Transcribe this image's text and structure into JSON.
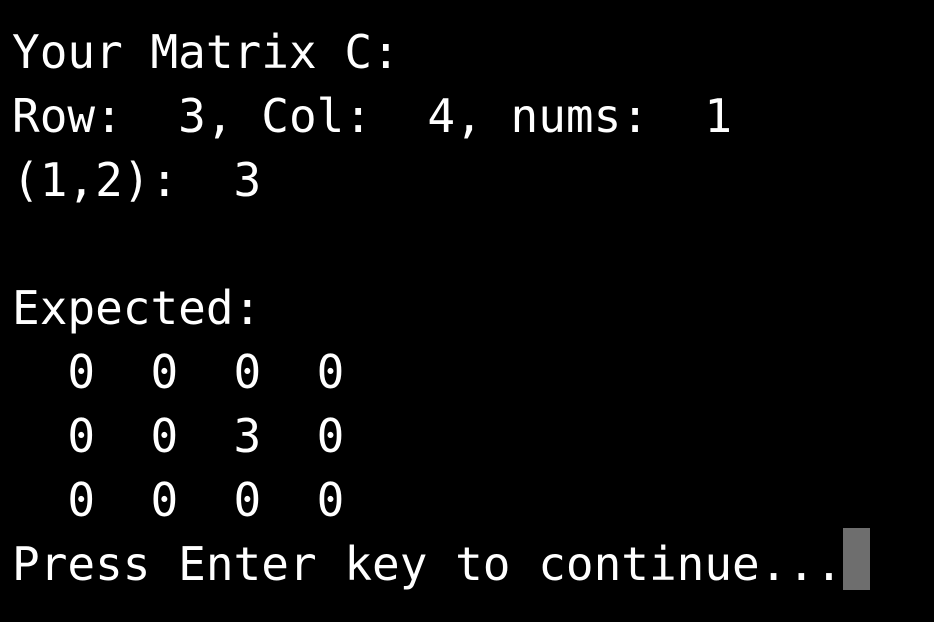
{
  "terminal": {
    "lines": [
      "Your Matrix C:",
      "Row:  3, Col:  4, nums:  1",
      "(1,2):  3",
      "",
      "Expected:",
      "  0  0  0  0",
      "  0  0  3  0",
      "  0  0  0  0"
    ],
    "prompt": "Press Enter key to continue...",
    "colors": {
      "background": "#000000",
      "foreground": "#ffffff",
      "cursor": "#6e6e6e"
    }
  }
}
